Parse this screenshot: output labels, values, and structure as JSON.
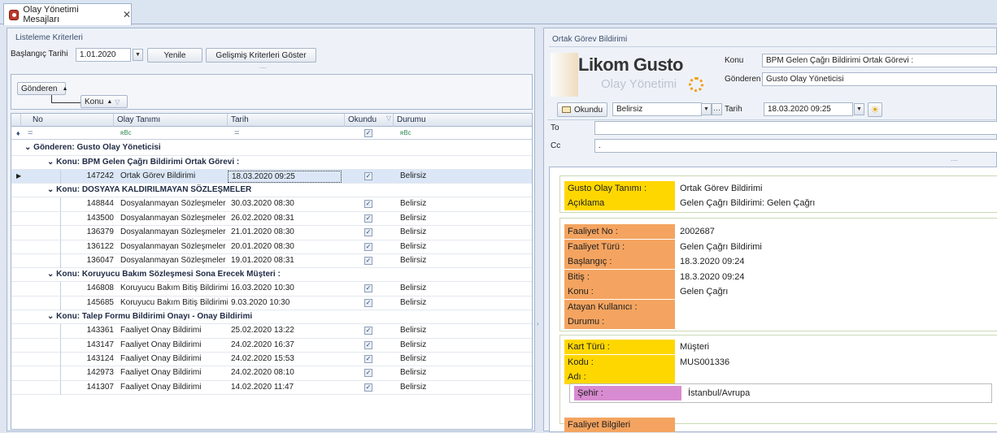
{
  "tab": {
    "title": "Olay Yönetimi Mesajları",
    "close": "✕"
  },
  "left": {
    "group_title": "Listeleme Kriterleri",
    "start_label": "Başlangıç Tarihi",
    "start_value": "1.01.2020",
    "refresh": "Yenile",
    "advanced": "Gelişmiş Kriterleri Göster",
    "more": "....",
    "groupby": [
      "Gönderen",
      "Konu"
    ],
    "columns": [
      "No",
      "Olay Tanımı",
      "Tarih",
      "Okundu",
      "Durumu"
    ],
    "filter_eq": "=",
    "filter_rbc": "ʀBc",
    "sender_group": "Gönderen: Gusto Olay Yöneticisi",
    "groups": [
      {
        "title": "Konu: BPM Gelen Çağrı Bildirimi Ortak Görevi :",
        "rows": [
          [
            "147242",
            "Ortak Görev Bildirimi",
            "18.03.2020 09:25",
            "Belirsiz"
          ]
        ]
      },
      {
        "title": "Konu: DOSYAYA KALDIRILMAYAN SÖZLEŞMELER",
        "rows": [
          [
            "148844",
            "Dosyalanmayan Sözleşmeler",
            "30.03.2020 08:30",
            "Belirsiz"
          ],
          [
            "143500",
            "Dosyalanmayan Sözleşmeler",
            "26.02.2020 08:31",
            "Belirsiz"
          ],
          [
            "136379",
            "Dosyalanmayan Sözleşmeler",
            "21.01.2020 08:30",
            "Belirsiz"
          ],
          [
            "136122",
            "Dosyalanmayan Sözleşmeler",
            "20.01.2020 08:30",
            "Belirsiz"
          ],
          [
            "136047",
            "Dosyalanmayan Sözleşmeler",
            "19.01.2020 08:31",
            "Belirsiz"
          ]
        ]
      },
      {
        "title": "Konu: Koruyucu Bakım  Sözleşmesi Sona Erecek Müşteri :",
        "rows": [
          [
            "146808",
            "Koruyucu Bakım Bitiş Bildirimi",
            "16.03.2020 10:30",
            "Belirsiz"
          ],
          [
            "145685",
            "Koruyucu Bakım Bitiş Bildirimi",
            "9.03.2020 10:30",
            "Belirsiz"
          ]
        ]
      },
      {
        "title": "Konu: Talep Formu Bildirimi Onayı - Onay Bildirimi",
        "rows": [
          [
            "143361",
            "Faaliyet Onay Bildirimi",
            "25.02.2020 13:22",
            "Belirsiz"
          ],
          [
            "143147",
            "Faaliyet Onay Bildirimi",
            "24.02.2020 16:37",
            "Belirsiz"
          ],
          [
            "143124",
            "Faaliyet Onay Bildirimi",
            "24.02.2020 15:53",
            "Belirsiz"
          ],
          [
            "142973",
            "Faaliyet Onay Bildirimi",
            "24.02.2020 08:10",
            "Belirsiz"
          ],
          [
            "141307",
            "Faaliyet Onay Bildirimi",
            "14.02.2020 11:47",
            "Belirsiz"
          ]
        ]
      }
    ]
  },
  "right": {
    "group_title": "Ortak Görev Bildirimi",
    "logo_main": "Likom Gusto",
    "logo_sub": "Olay Yönetimi",
    "konu_label": "Konu",
    "konu_value": "BPM Gelen Çağrı Bildirimi Ortak Görevi :",
    "gonderen_label": "Gönderen",
    "gonderen_value": "Gusto Olay Yöneticisi",
    "okundu": "Okundu",
    "status": "Belirsiz",
    "tarih_label": "Tarih",
    "tarih_value": "18.03.2020 09:25",
    "ellipsis": "···",
    "to": "To",
    "cc": "Cc",
    "cc_value": ".",
    "more": "....",
    "body": {
      "s1": [
        [
          "Gusto Olay Tanımı :",
          "Ortak Görev Bildirimi"
        ],
        [
          "Açıklama",
          "Gelen Çağrı Bildirimi: Gelen Çağrı"
        ]
      ],
      "s2": [
        [
          "Faaliyet No :",
          "2002687"
        ],
        [
          "Faaliyet Türü :",
          "Gelen Çağrı Bildirimi"
        ],
        [
          "Başlangıç :",
          "18.3.2020 09:24"
        ],
        [
          "Bitiş :",
          "18.3.2020 09:24"
        ],
        [
          "Konu :",
          "Gelen Çağrı"
        ],
        [
          "Atayan Kullanıcı :",
          ""
        ],
        [
          "Durumu :",
          ""
        ]
      ],
      "s3": [
        [
          "Kart Türü :",
          "Müşteri"
        ],
        [
          "Kodu :",
          "MUS001336"
        ],
        [
          "Adı :",
          ""
        ]
      ],
      "sehir": [
        "Şehir :",
        "İstanbul/Avrupa"
      ],
      "faaliyet": "Faaliyet Bilgileri"
    }
  },
  "colors": {
    "orange": "#f4a460",
    "yellow": "#ffd700",
    "pink": "#d88bd0",
    "selected": "#dbe7f7"
  }
}
